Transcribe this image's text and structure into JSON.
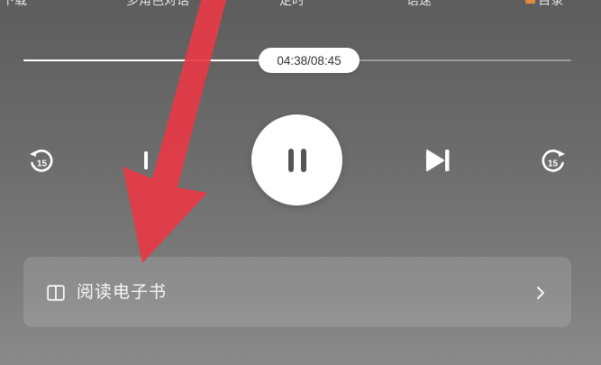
{
  "top_menu": {
    "items": [
      {
        "label": "下载"
      },
      {
        "label": "多角色对话"
      },
      {
        "label": "定时"
      },
      {
        "label": "语速"
      },
      {
        "label": "目录"
      }
    ]
  },
  "player": {
    "progress_fraction": 0.526,
    "time_label": "04:38/08:45",
    "rewind_seconds": "15",
    "forward_seconds": "15"
  },
  "ebook": {
    "label": "阅读电子书"
  },
  "icons": {
    "rewind": "rewind-15-icon",
    "previous": "previous-track-icon",
    "pause": "pause-icon",
    "next": "next-track-icon",
    "forward": "forward-15-icon",
    "book": "book-icon",
    "chevron": "chevron-right-icon"
  },
  "colors": {
    "annotation_arrow": "#e63a46",
    "accent": "#e08a3c"
  }
}
